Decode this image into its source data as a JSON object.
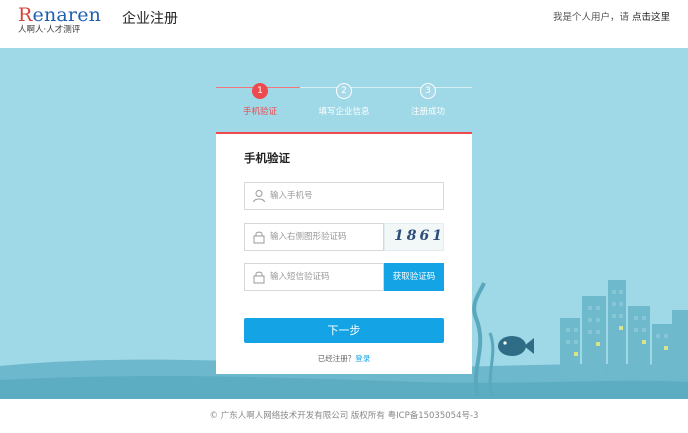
{
  "header": {
    "logo_text": "Renaren",
    "logo_first_letter": "R",
    "logo_rest": "enaren",
    "logo_subtitle": "人啊人·人才测评",
    "page_title": "企业注册",
    "personal_prefix": "我是个人用户，请 ",
    "personal_link": "点击这里"
  },
  "steps": [
    {
      "number": "1",
      "label": "手机验证",
      "active": true
    },
    {
      "number": "2",
      "label": "填写企业信息",
      "active": false
    },
    {
      "number": "3",
      "label": "注册成功",
      "active": false
    }
  ],
  "form": {
    "title": "手机验证",
    "phone": {
      "value": "",
      "placeholder": "输入手机号",
      "icon": "user-icon"
    },
    "captcha": {
      "value": "",
      "placeholder": "输入右侧图形验证码",
      "icon": "lock-icon",
      "image_text": "1861"
    },
    "sms_code": {
      "value": "",
      "placeholder": "输入短信验证码",
      "icon": "lock-icon"
    },
    "sms_button": "获取验证码",
    "next_button": "下一步",
    "registered_text": "已经注册？",
    "login_link": "登录"
  },
  "footer": {
    "copyright": "© 广东人啊人网络技术开发有限公司 版权所有 粤ICP备15035054号-3"
  },
  "colors": {
    "accent_red": "#ee4a4d",
    "primary_blue": "#14a4e6",
    "hero_bg": "#9fd8e7",
    "logo_blue": "#1f5fb0"
  }
}
